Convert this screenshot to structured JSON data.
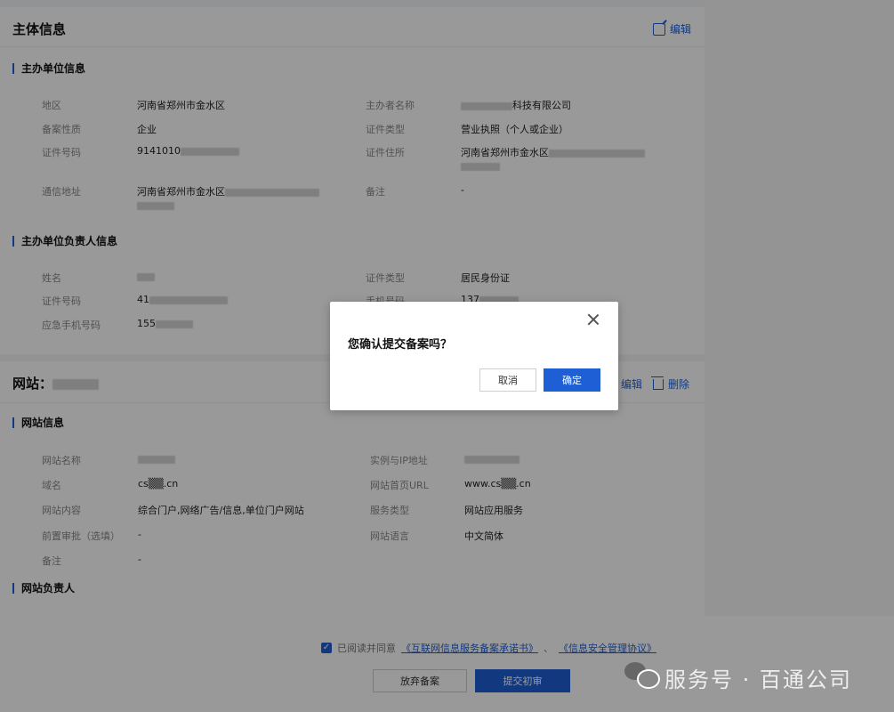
{
  "subject": {
    "title": "主体信息",
    "edit": "编辑",
    "unit_section": "主办单位信息",
    "fields": {
      "region_label": "地区",
      "region": "河南省郑州市金水区",
      "sponsor_label": "主办者名称",
      "sponsor": "科技有限公司",
      "nature_label": "备案性质",
      "nature": "企业",
      "cert_type_label": "证件类型",
      "cert_type": "营业执照（个人或企业）",
      "cert_no_label": "证件号码",
      "cert_no": "9141010",
      "cert_addr_label": "证件住所",
      "cert_addr": "河南省郑州市金水区",
      "mail_addr_label": "通信地址",
      "mail_addr": "河南省郑州市金水区",
      "remark_label": "备注",
      "remark": "-"
    },
    "leader_section": "主办单位负责人信息",
    "leader": {
      "name_label": "姓名",
      "id_type_label": "证件类型",
      "id_type": "居民身份证",
      "id_no_label": "证件号码",
      "id_no": "41",
      "mobile_label": "手机号码",
      "mobile": "137",
      "emergency_label": "应急手机号码",
      "emergency": "155"
    }
  },
  "website": {
    "title": "网站：",
    "edit": "编辑",
    "delete": "删除",
    "info_section": "网站信息",
    "fields": {
      "site_name_label": "网站名称",
      "instance_label": "实例与IP地址",
      "domain_label": "域名",
      "domain": "cs▒▒.cn",
      "homepage_label": "网站首页URL",
      "homepage": "www.cs▒▒.cn",
      "content_label": "网站内容",
      "content": "综合门户,网络广告/信息,单位门户网站",
      "service_label": "服务类型",
      "service": "网站应用服务",
      "preapproval_label": "前置审批（选填）",
      "preapproval": "-",
      "lang_label": "网站语言",
      "lang": "中文简体",
      "remark_label": "备注",
      "remark": "-"
    },
    "leader_section": "网站负责人"
  },
  "footer": {
    "agree_prefix": "已阅读并同意",
    "link1": "《互联网信息服务备案承诺书》",
    "sep": "、",
    "link2": "《信息安全管理协议》",
    "abandon": "放弃备案",
    "submit": "提交初审"
  },
  "modal": {
    "message": "您确认提交备案吗？",
    "cancel": "取消",
    "confirm": "确定"
  },
  "watermark": "服务号 · 百通公司",
  "colors": {
    "accent": "#1f5fd6",
    "overlay": "rgba(0,0,0,0.40)"
  }
}
